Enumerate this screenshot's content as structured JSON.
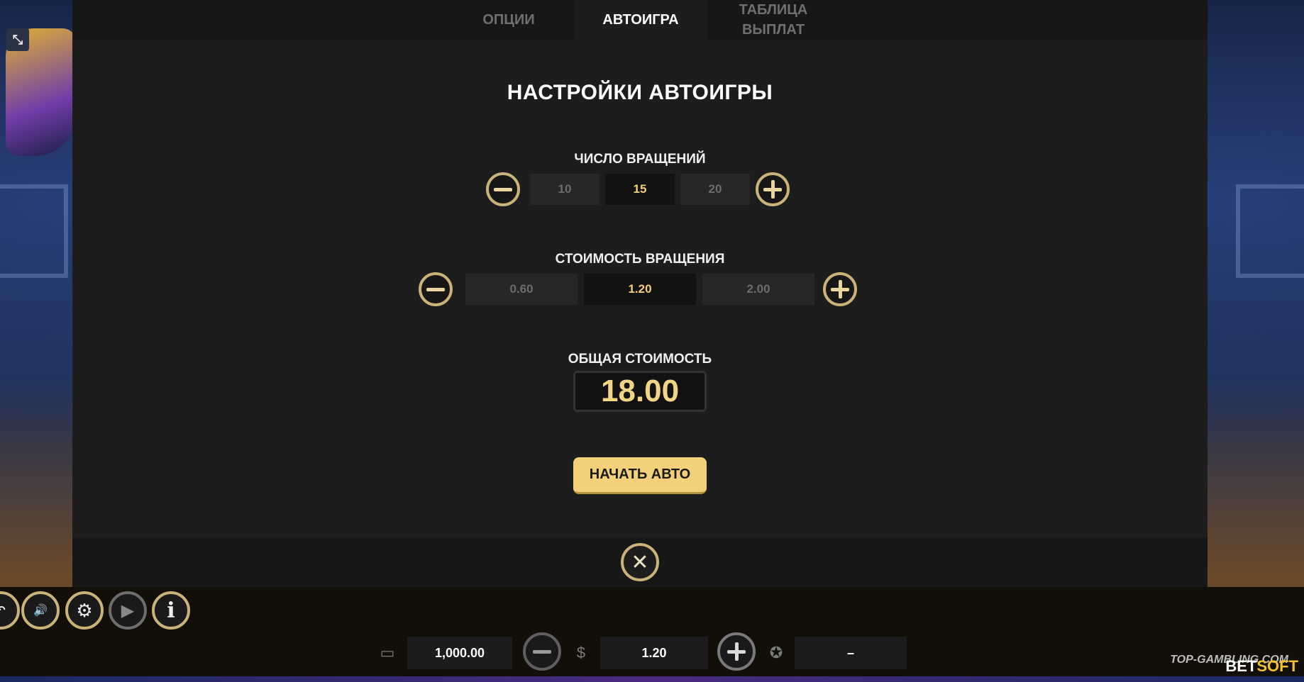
{
  "tabs": [
    {
      "label": "ОПЦИИ"
    },
    {
      "label": "АВТОИГРА",
      "active": true
    },
    {
      "label": "ТАБЛИЦА ВЫПЛАТ"
    }
  ],
  "title": "НАСТРОЙКИ АВТОИГРЫ",
  "spins": {
    "label": "ЧИСЛО ВРАЩЕНИЙ",
    "options": [
      "10",
      "15",
      "20"
    ],
    "selected": "15"
  },
  "spin_cost": {
    "label": "СТОИМОСТЬ ВРАЩЕНИЯ",
    "options": [
      "0.60",
      "1.20",
      "2.00"
    ],
    "selected": "1.20"
  },
  "total": {
    "label": "ОБЩАЯ СТОИМОСТЬ",
    "value": "18.00"
  },
  "start_button": "НАЧАТЬ АВТО",
  "bottom_bar": {
    "balance": "1,000.00",
    "bet": "1.20",
    "win": "–"
  },
  "watermark": "TOP-GAMBLING.COM",
  "brand": {
    "part1": "BET",
    "part2": "SOFT"
  },
  "icons": {
    "collapse": "collapse-icon",
    "minus": "minus-icon",
    "plus": "plus-icon",
    "close": "close-icon",
    "sound": "sound-icon",
    "settings": "gear-icon",
    "autoplay": "autoplay-icon",
    "info": "info-icon",
    "wallet": "wallet-icon",
    "coins": "coins-icon",
    "award": "award-icon"
  },
  "colors": {
    "accent_gold": "#f3d07a",
    "selected_text": "#f2cf78",
    "panel_bg": "#1d1d1d"
  }
}
